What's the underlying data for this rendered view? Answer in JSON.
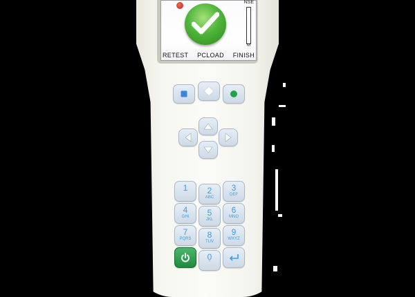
{
  "screen": {
    "softkeys": [
      "RETEST",
      "PCLOAD",
      "FINISH"
    ],
    "level_top_label": "NSE",
    "level_bottom_label": "M",
    "result_icon": "check-icon"
  },
  "function_keys": [
    {
      "icon": "stop-square-icon",
      "color": "#3a86d8"
    },
    {
      "icon": "diamond-icon",
      "color": "#ffffff"
    },
    {
      "icon": "record-dot-icon",
      "color": "#22a34a"
    }
  ],
  "dpad": [
    "up-arrow-icon",
    "left-arrow-icon",
    "right-arrow-icon",
    "down-arrow-icon"
  ],
  "keypad": [
    {
      "num": "1",
      "sub": ""
    },
    {
      "num": "2",
      "sub": "ABC"
    },
    {
      "num": "3",
      "sub": "DEF"
    },
    {
      "num": "4",
      "sub": "GHI"
    },
    {
      "num": "5",
      "sub": "JKL"
    },
    {
      "num": "6",
      "sub": "MNO"
    },
    {
      "num": "7",
      "sub": "PQRS"
    },
    {
      "num": "8",
      "sub": "TUV"
    },
    {
      "num": "9",
      "sub": "WXYZ"
    },
    {
      "num": "",
      "sub": "",
      "icon": "power-icon"
    },
    {
      "num": "0",
      "sub": ""
    },
    {
      "num": "",
      "sub": "",
      "icon": "backspace-icon"
    }
  ],
  "colors": {
    "key_text": "#3b9ee0",
    "check_green": "#4fb53a",
    "power_green": "#1f8a3e"
  }
}
